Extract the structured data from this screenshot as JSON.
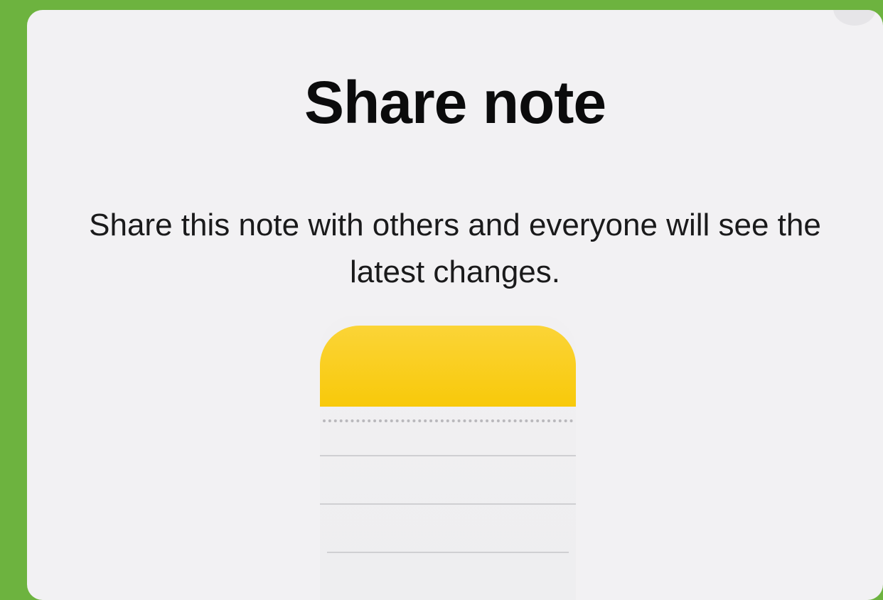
{
  "dialog": {
    "title": "Share note",
    "description": "Share this note with others and everyone will see the latest changes.",
    "icon": "notes-app-icon"
  },
  "colors": {
    "background": "#6db33f",
    "sheet": "#f2f1f3",
    "icon_yellow": "#f8c90a",
    "text": "#0b0b0c"
  }
}
